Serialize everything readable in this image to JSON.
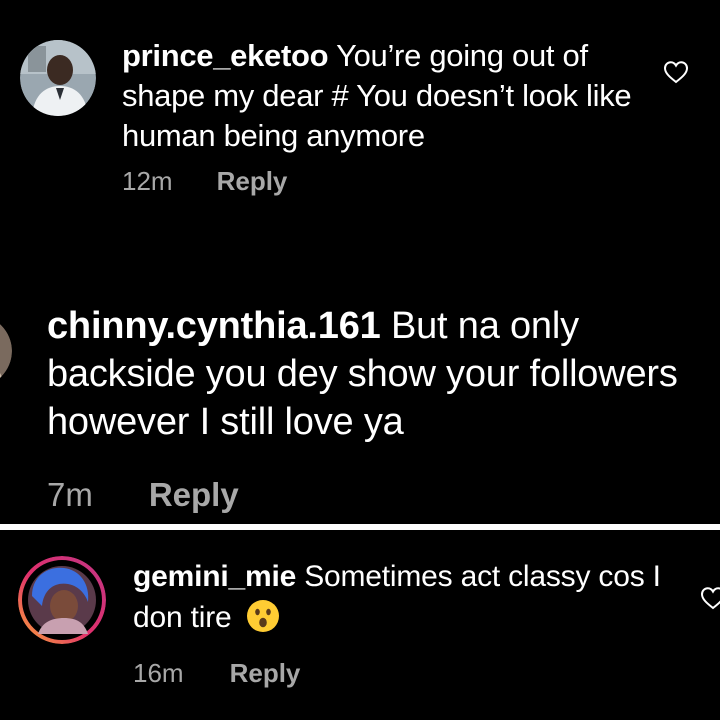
{
  "comments": [
    {
      "username": "prince_eketoo",
      "text": "You’re going out of shape my dear # You doesn’t look like human being anymore",
      "time": "12m",
      "reply_label": "Reply",
      "avatar_icon": "user-avatar-photo",
      "has_like_icon": true
    },
    {
      "username": "chinny.cynthia.161",
      "text": "But na only backside you dey show your followers however I still love ya",
      "time": "7m",
      "reply_label": "Reply",
      "avatar_icon": "user-avatar-photo"
    },
    {
      "username": "gemini_mie",
      "text": "Sometimes act classy cos I don tire",
      "emoji": "astonished-face-emoji",
      "time": "16m",
      "reply_label": "Reply",
      "avatar_icon": "story-ring-avatar-photo",
      "has_like_icon": true
    }
  ],
  "colors": {
    "background": "#000000",
    "text_primary": "#ffffff",
    "text_secondary": "#a8a8a8",
    "divider": "#ffffff",
    "story_ring": "#d6249f"
  }
}
